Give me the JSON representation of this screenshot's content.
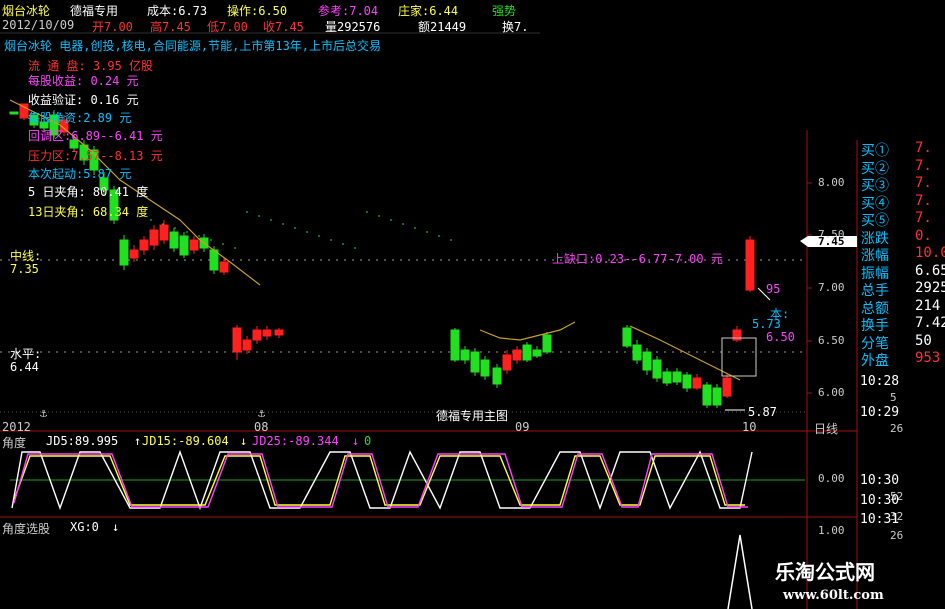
{
  "header": {
    "stock_name": "烟台冰轮",
    "formula_name": "德福专用",
    "cost": "成本:6.73",
    "operate": "操作:6.50",
    "reference": "参考:7.04",
    "dealer": "庄家:6.44",
    "strong": "强势",
    "date": "2012/10/09",
    "open": "开7.00",
    "high": "高7.45",
    "low": "低7.00",
    "close": "收7.45",
    "volume": "量292576",
    "amount": "额21449",
    "turnover": "换7."
  },
  "info": {
    "company_line": "烟台冰轮  电器,创投,核电,合同能源,节能,上市第13年,上市后总交易",
    "circulation": "流   通   盘: 3.95 亿股",
    "eps": "每股收益:  0.24  元",
    "earnings_check": "收益验证:  0.16  元",
    "nav": "每股净资:2.89 元",
    "pullback": "回调区:6.89--6.41 元",
    "pressure": "压力区:7.57--8.13 元",
    "rise": "本次起动:5.87 元",
    "angle5": "5 日夹角: 80.41 度",
    "angle13": "13日夹角: 68.34 度",
    "mid_line_label": "中线:",
    "mid_line_value": "7.35",
    "level_label": "水平:",
    "level_value": "6.44",
    "gap_label": "上缺口:0.23--6.77-7.00 元",
    "low_marker": "5.87",
    "main_chart_title": "德福专用主图",
    "this_marker": "本:",
    "marker_573": "5.73",
    "marker_650": "6.50",
    "marker_95": "95"
  },
  "price_axis": [
    "8.00",
    "7.50",
    "7.00",
    "6.50",
    "6.00"
  ],
  "current_price_tag": "7.45",
  "x_axis": {
    "labels": [
      "2012",
      "08",
      "09",
      "10"
    ],
    "period": "日线"
  },
  "indicator1": {
    "title": "角度",
    "jd5": "JD5:89.995",
    "jd15": "JD15:-89.604",
    "jd25": "JD25:-89.344",
    "extra": "0",
    "axis_label": "0.00"
  },
  "indicator2": {
    "title": "角度选股",
    "xg": "XG:0",
    "axis_label": "1.00"
  },
  "right_panel": {
    "rows": [
      {
        "label": "买①",
        "value": "7."
      },
      {
        "label": "买②",
        "value": "7."
      },
      {
        "label": "买③",
        "value": "7."
      },
      {
        "label": "买④",
        "value": "7."
      },
      {
        "label": "买⑤",
        "value": "7."
      },
      {
        "label": "涨跌",
        "value": "0."
      },
      {
        "label": "涨幅",
        "value": "10.0"
      },
      {
        "label": "振幅",
        "value": "6.65"
      },
      {
        "label": "总手",
        "value": "2925"
      },
      {
        "label": "总额",
        "value": "214"
      },
      {
        "label": "换手",
        "value": "7.42"
      },
      {
        "label": "分笔",
        "value": "50"
      },
      {
        "label": "外盘",
        "value": "953"
      }
    ],
    "ticks": [
      {
        "time": "10:28",
        "n": "5"
      },
      {
        "time": "10:29",
        "n": "26"
      },
      {
        "time": "10:30",
        "n": "52"
      },
      {
        "time": "10:30",
        "n": "32"
      },
      {
        "time": "10:31",
        "n": "26"
      }
    ]
  },
  "watermark": {
    "title": "乐淘公式网",
    "url": "www.60lt.com"
  },
  "colors": {
    "up": "#ff2020",
    "down": "#20e020",
    "ma": "#c8a020",
    "grid": "#801010",
    "label_cyan": "#00c0ff",
    "label_magenta": "#ff40ff",
    "label_red": "#ff3030",
    "label_yellow": "#ffff40"
  }
}
